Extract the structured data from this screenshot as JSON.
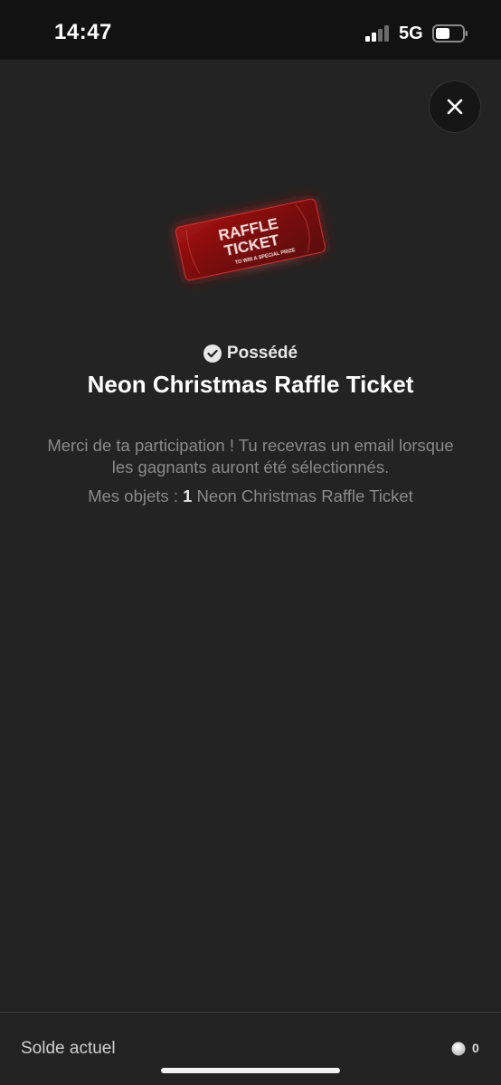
{
  "status_bar": {
    "time": "14:47",
    "network": "5G",
    "icons": [
      "signal-icon",
      "battery-icon"
    ]
  },
  "close": {
    "icon": "close-icon"
  },
  "ticket": {
    "line1": "RAFFLE",
    "line2": "TICKET",
    "subtitle": "TO WIN A SPECIAL PRIZE",
    "color": "#8e1111"
  },
  "item": {
    "status": "Possédé",
    "status_icon": "check-circle-icon",
    "title": "Neon Christmas Raffle Ticket",
    "description": "Merci de ta participation ! Tu recevras un email lorsque les gagnants auront été sélectionnés.",
    "owned_prefix": "Mes objets : ",
    "owned_count": "1",
    "owned_name": " Neon Christmas Raffle Ticket"
  },
  "footer": {
    "balance_label": "Solde actuel",
    "balance_value": "0",
    "coin_icon": "coin-icon"
  }
}
